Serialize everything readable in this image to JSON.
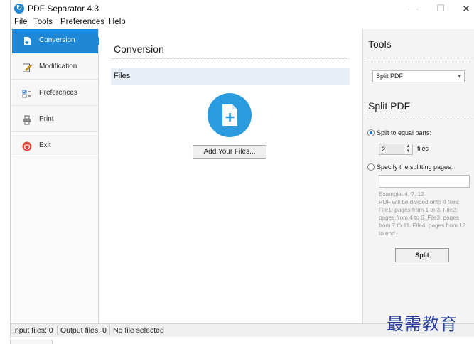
{
  "window": {
    "title": "PDF Separator 4.3"
  },
  "title_controls": {
    "minimize": "—",
    "maximize": "☐",
    "close": "✕"
  },
  "menu": [
    "File",
    "Tools",
    "Preferences",
    "Help"
  ],
  "sidebar": {
    "items": [
      {
        "label": "Conversion",
        "icon": "document-add-icon",
        "active": true
      },
      {
        "label": "Modification",
        "icon": "edit-icon",
        "active": false
      },
      {
        "label": "Preferences",
        "icon": "checklist-icon",
        "active": false
      },
      {
        "label": "Print",
        "icon": "printer-icon",
        "active": false
      },
      {
        "label": "Exit",
        "icon": "power-icon",
        "active": false
      }
    ]
  },
  "main": {
    "title": "Conversion",
    "files_header": "Files",
    "add_files_button": "Add Your Files..."
  },
  "tools": {
    "title": "Tools",
    "selected_tool": "Split PDF",
    "split_title": "Split PDF",
    "option_equal": "Split to equal parts:",
    "equal_parts_value": "2",
    "files_unit": "files",
    "option_specify": "Specify the splitting pages:",
    "pages_value": "",
    "hint_example": "Example: 4, 7, 12",
    "hint_body": "PDF will be divided onto 4 files: File1: pages from 1 to 3. File2: pages from 4 to 6. File3: pages from 7 to 11. File4: pages from 12 to end.",
    "split_button": "Split"
  },
  "status": {
    "input_files": "Input files: 0",
    "output_files": "Output files: 0",
    "selection": "No file selected"
  },
  "watermark": "最需教育",
  "colors": {
    "accent": "#1e88d6",
    "add_circle": "#2b9be0",
    "files_bar": "#e8eef6"
  }
}
